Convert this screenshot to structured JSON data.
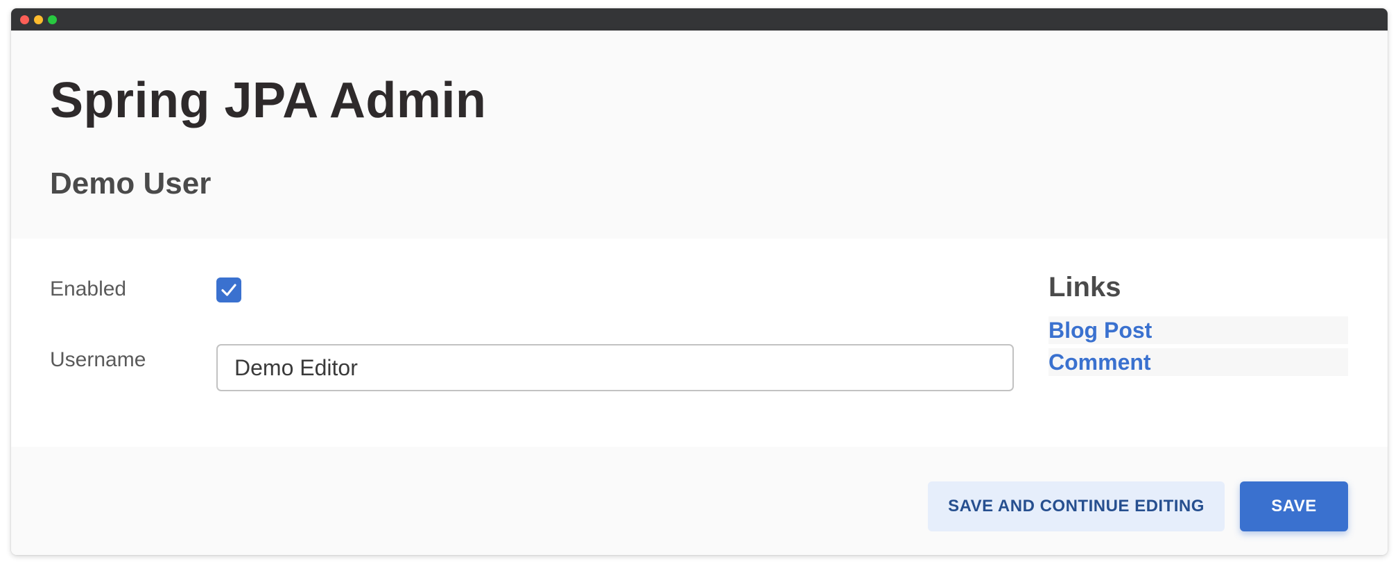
{
  "app": {
    "title": "Spring JPA Admin"
  },
  "page": {
    "title": "Demo User"
  },
  "form": {
    "enabled": {
      "label": "Enabled",
      "checked": true
    },
    "username": {
      "label": "Username",
      "value": "Demo Editor"
    }
  },
  "links": {
    "heading": "Links",
    "items": [
      {
        "label": "Blog Post"
      },
      {
        "label": "Comment"
      }
    ]
  },
  "actions": {
    "save_continue_label": "SAVE AND CONTINUE EDITING",
    "save_label": "SAVE"
  },
  "colors": {
    "accent": "#3a71cf",
    "titlebar": "#343537",
    "secondary_button_bg": "#e6eefb"
  },
  "icons": {
    "checkbox": "checkmark-icon"
  }
}
